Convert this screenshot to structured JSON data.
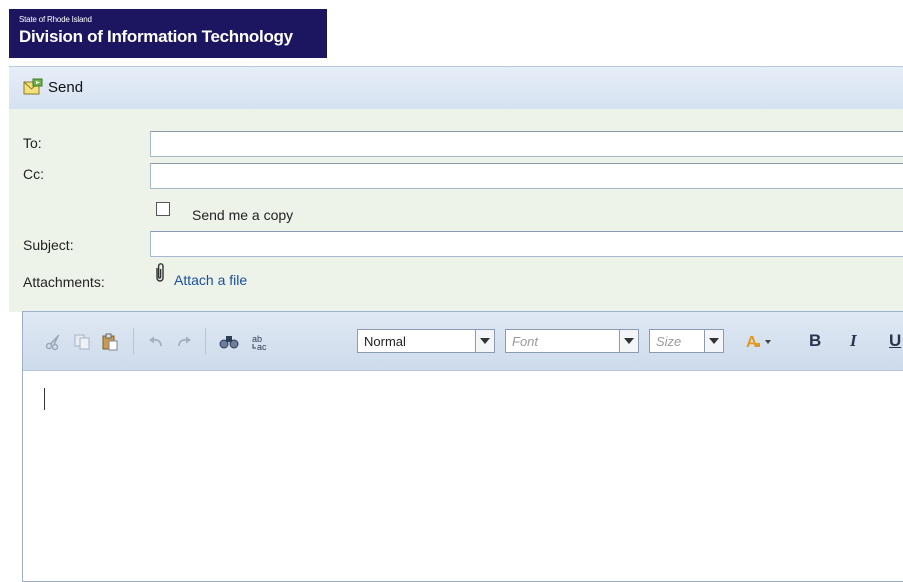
{
  "header": {
    "org_line": "State of Rhode Island",
    "title": "Division of Information Technology"
  },
  "toolbar": {
    "send_label": "Send"
  },
  "form": {
    "to_label": "To:",
    "to_value": "",
    "cc_label": "Cc:",
    "cc_value": "",
    "copy_checkbox_label": "Send me a copy",
    "copy_checked": false,
    "subject_label": "Subject:",
    "subject_value": "",
    "attachments_label": "Attachments:",
    "attach_link": "Attach a file"
  },
  "editor": {
    "format_select": "Normal",
    "font_select": "Font",
    "size_select": "Size",
    "bold_label": "B",
    "italic_label": "I",
    "underline_label": "U",
    "icons": [
      "cut-icon",
      "copy-icon",
      "paste-icon",
      "undo-icon",
      "redo-icon",
      "find-icon",
      "replace-icon",
      "text-color-icon"
    ]
  },
  "colors": {
    "banner": "#1c1660",
    "toolbar": "#d6e2f1",
    "form_bg": "#eef3e9",
    "link": "#1a4f9a"
  }
}
